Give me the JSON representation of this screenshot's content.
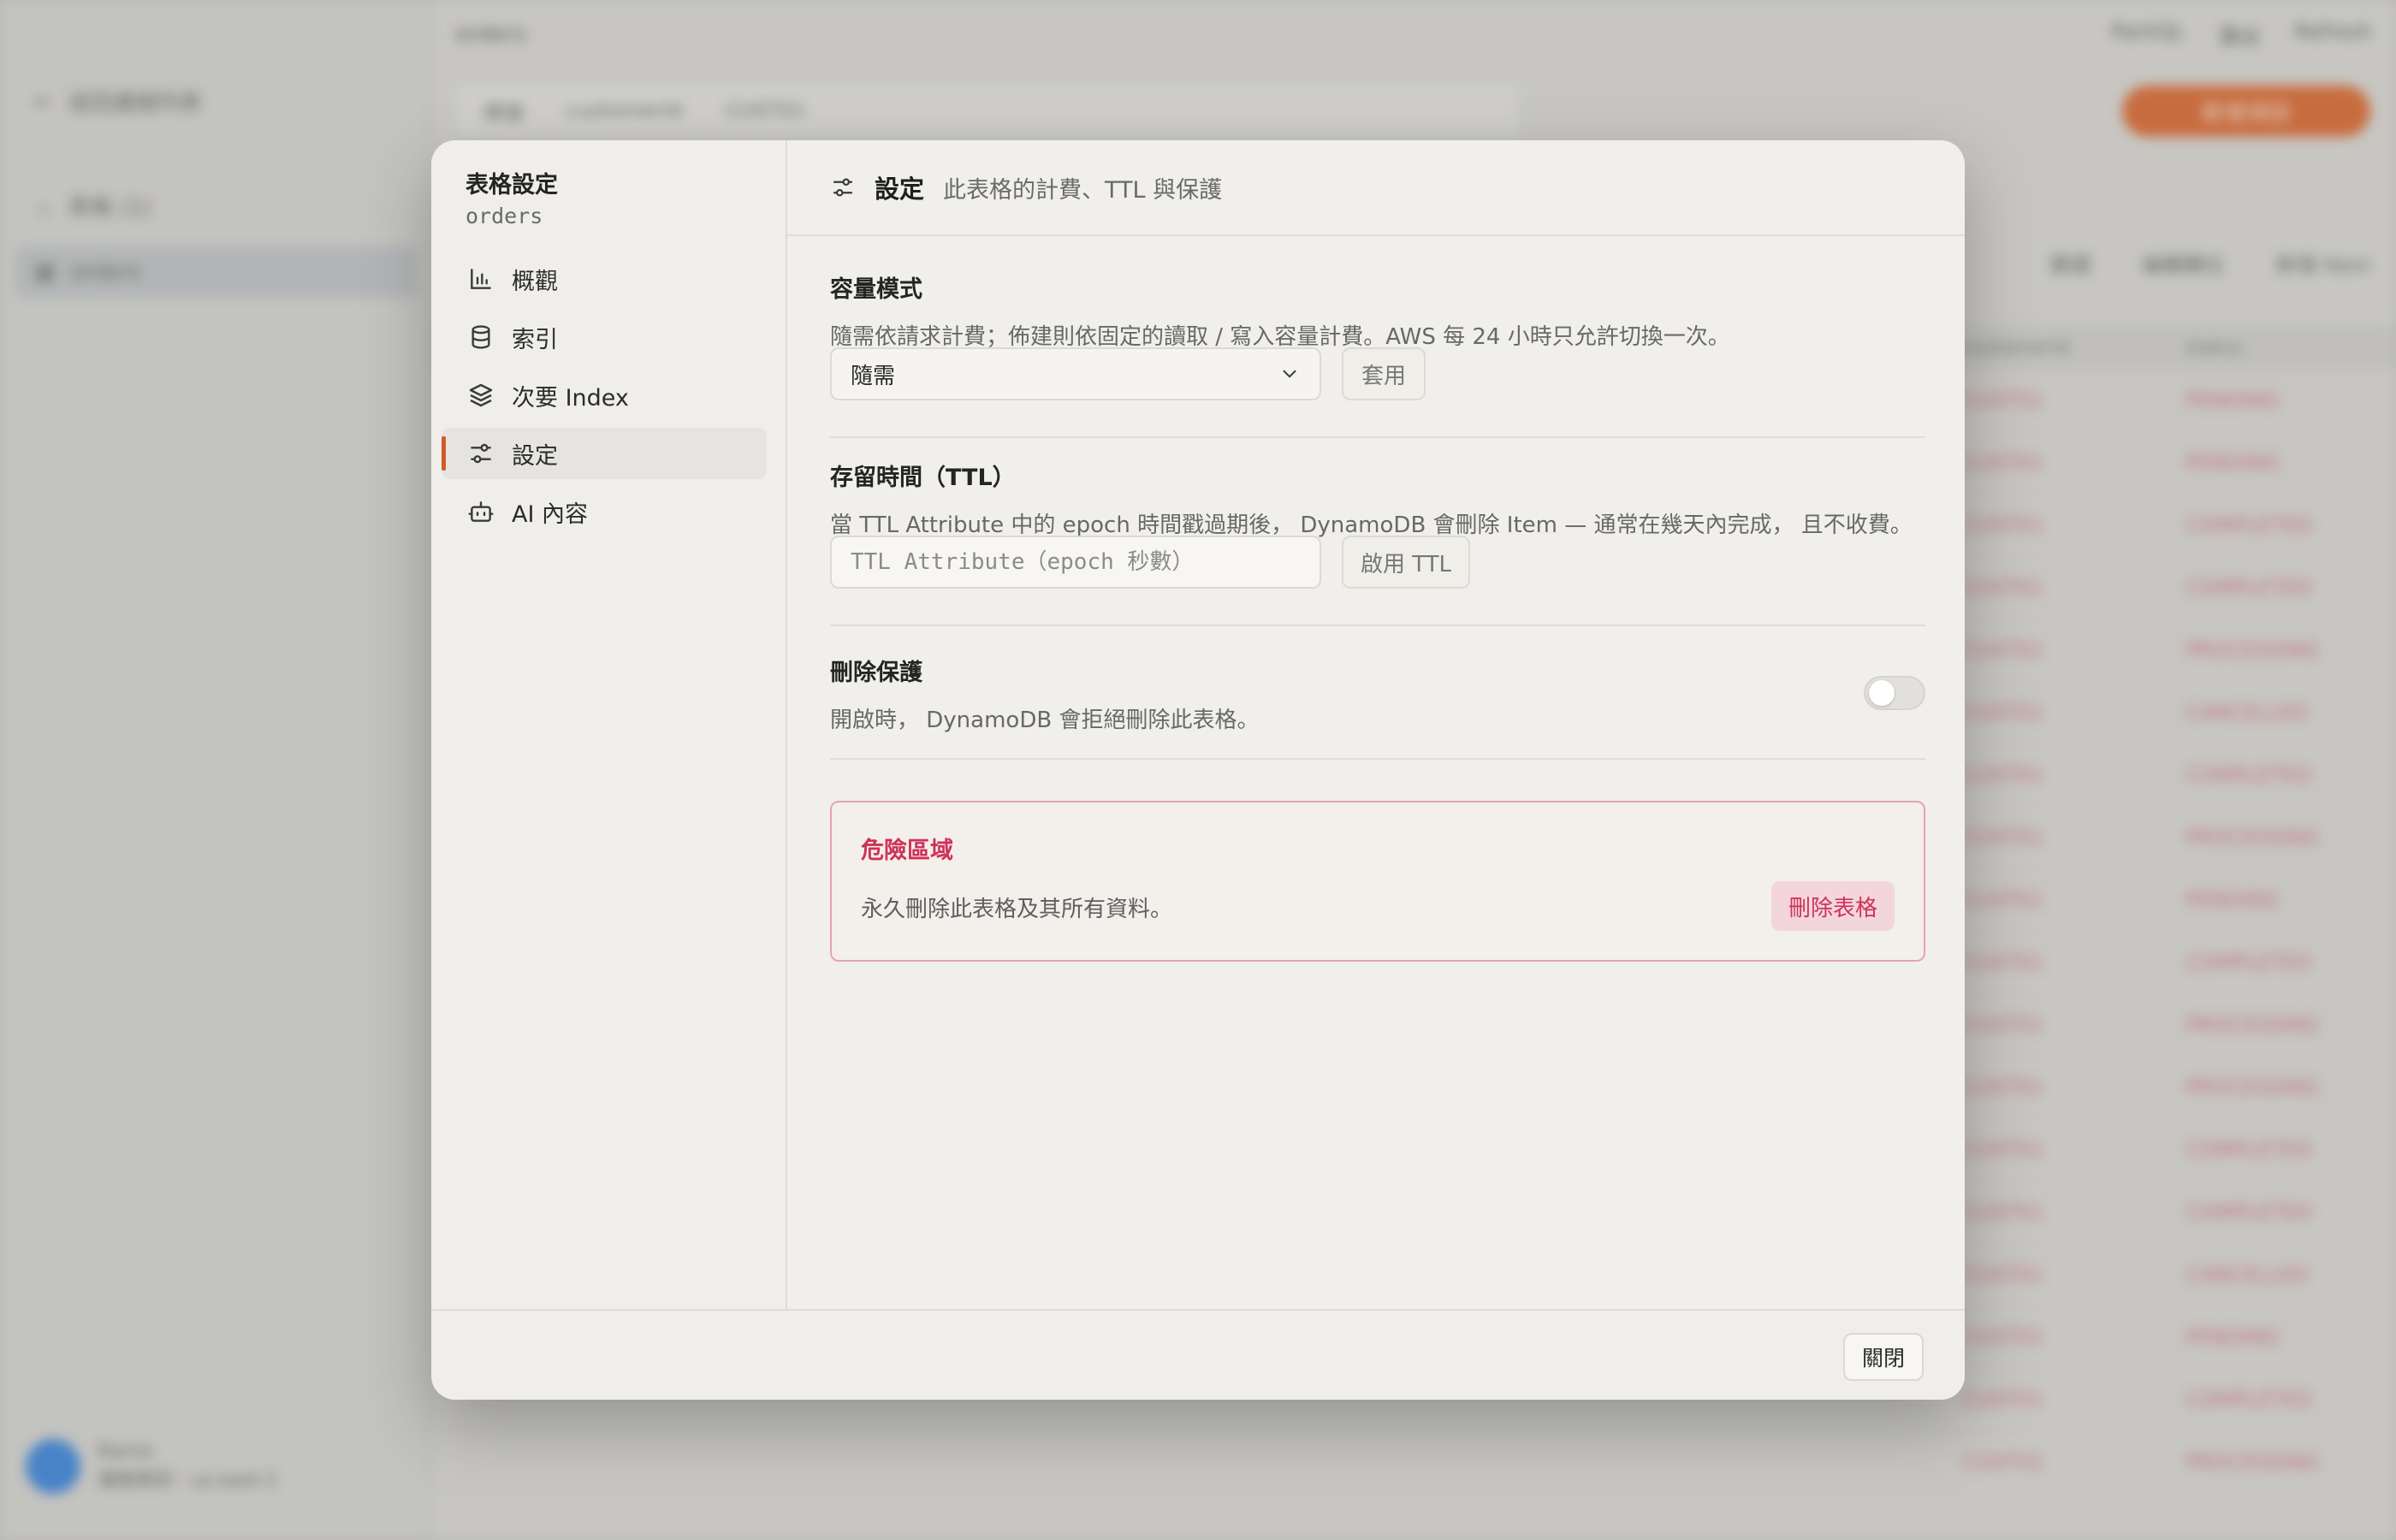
{
  "background": {
    "sidebar": {
      "items": [
        {
          "label": "返回連線列表"
        },
        {
          "label": "表格 (1)"
        },
        {
          "label": "orders"
        }
      ],
      "user": {
        "name": "Name",
        "subtitle": "連線資訊 · us-east-1"
      }
    },
    "topbar": {
      "title": "orders",
      "actions": [
        "PartiQL",
        "匯出",
        "Refresh"
      ]
    },
    "filter": {
      "mode": "掃描",
      "key": "customerId",
      "value": "CUST01"
    },
    "add_button": "新增項目",
    "table_actions": [
      "篩選",
      "編輯欄位",
      "新增 Item"
    ],
    "columns": [
      "customerId",
      "status"
    ],
    "rows": [
      {
        "status": "PENDING"
      },
      {
        "status": "PENDING"
      },
      {
        "status": "COMPLETED"
      },
      {
        "status": "COMPLETED"
      },
      {
        "status": "PROCESSING"
      },
      {
        "status": "CANCELLED"
      },
      {
        "status": "COMPLETED"
      },
      {
        "status": "PROCESSING"
      },
      {
        "status": "PENDING"
      },
      {
        "status": "COMPLETED"
      },
      {
        "status": "PROCESSING"
      },
      {
        "status": "PROCESSING"
      },
      {
        "status": "COMPLETED"
      },
      {
        "status": "COMPLETED"
      },
      {
        "status": "CANCELLED"
      },
      {
        "status": "PENDING"
      },
      {
        "status": "COMPLETED"
      },
      {
        "status": "PROCESSING"
      }
    ]
  },
  "modal": {
    "title": "表格設定",
    "subtitle": "orders",
    "nav": [
      {
        "label": "概觀",
        "icon": "bar-chart-icon"
      },
      {
        "label": "索引",
        "icon": "database-icon"
      },
      {
        "label": "次要 Index",
        "icon": "layers-icon"
      },
      {
        "label": "設定",
        "icon": "sliders-icon",
        "active": true
      },
      {
        "label": "AI 內容",
        "icon": "bot-icon"
      }
    ],
    "header": {
      "title": "設定",
      "description": "此表格的計費、TTL 與保護"
    },
    "capacity": {
      "title": "容量模式",
      "description": "隨需依請求計費；佈建則依固定的讀取 / 寫入容量計費。AWS 每 24 小時只允許切換一次。",
      "selected": "隨需",
      "apply_label": "套用"
    },
    "ttl": {
      "title": "存留時間（TTL）",
      "description": "當 TTL Attribute 中的 epoch 時間戳過期後， DynamoDB 會刪除 Item — 通常在幾天內完成， 且不收費。",
      "placeholder": "TTL Attribute（epoch 秒數）",
      "enable_label": "啟用 TTL"
    },
    "protection": {
      "title": "刪除保護",
      "description": "開啟時， DynamoDB 會拒絕刪除此表格。",
      "enabled": false
    },
    "danger": {
      "title": "危險區域",
      "description": "永久刪除此表格及其所有資料。",
      "button": "刪除表格",
      "color": "#cf3258"
    },
    "footer": {
      "close_label": "關閉"
    },
    "accent_color": "#d4592a"
  }
}
